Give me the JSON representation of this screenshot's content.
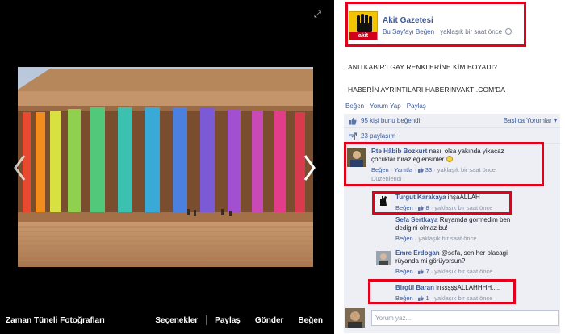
{
  "viewer": {
    "album_title": "Zaman Tüneli Fotoğrafları",
    "actions": {
      "options": "Seçenekler",
      "share": "Paylaş",
      "send": "Gönder",
      "like": "Beğen"
    }
  },
  "post": {
    "page_name": "Akit Gazetesi",
    "page_logo_text": "akit",
    "like_page": "Bu Sayfayı Beğen",
    "time": "yaklaşık bir saat önce",
    "text_line1": "ANITKABIR'İ GAY RENKLERİNE KİM BOYADI?",
    "text_line2": "HABERİN AYRINTILARI HABERINVAKTI.COM'DA",
    "actions": {
      "like": "Beğen",
      "comment": "Yorum Yap",
      "share": "Paylaş"
    },
    "likes_count_link": "95 kişi",
    "likes_text": " bunu beğendi.",
    "sort_label": "Başlıca Yorumlar",
    "shares_text": "23 paylaşım"
  },
  "comments": [
    {
      "name": "Rte Hâbib Bozkurt",
      "text1": "nasıl olsa yakında yikacaz",
      "text2": "çocuklar biraz eglensinler",
      "like": "Beğen",
      "reply": "Yanıtla",
      "likes": "33",
      "time": "yaklaşık bir saat önce",
      "edited": "Düzenlendi"
    },
    {
      "name": "Turgut Karakaya",
      "text1": "inşaALLAH",
      "like": "Beğen",
      "likes": "8",
      "time": "yaklaşık bir saat önce"
    },
    {
      "name": "Sefa Sertkaya",
      "text1": "Ruyamda gormedim ben",
      "text2": "dedigini olmaz bu!",
      "like": "Beğen",
      "time": "yaklaşık bir saat önce"
    },
    {
      "name": "Emre Erdogan",
      "text1": "@sefa, sen her olacagi",
      "text2": "rüyanda mi görüyorsun?",
      "like": "Beğen",
      "likes": "7",
      "time": "yaklaşık bir saat önce"
    },
    {
      "name": "Birgül Baran",
      "text1": "insşşşşALLAHHHH.....",
      "like": "Beğen",
      "likes": "1",
      "time": "yaklaşık bir saat önce"
    }
  ],
  "reply_placeholder": "Yorum yaz...",
  "colors": {
    "link": "#3b5998",
    "highlight": "#e2001a",
    "panel": "#edeff4",
    "viewer_bg": "#000000"
  }
}
